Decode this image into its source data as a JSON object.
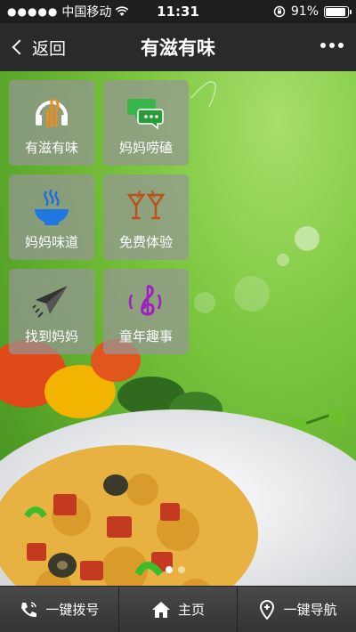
{
  "status_bar": {
    "carrier": "中国移动",
    "time": "11:31",
    "battery": "91%",
    "battery_level": 0.91
  },
  "nav": {
    "back_label": "返回",
    "title": "有滋有味"
  },
  "tiles": [
    {
      "label": "有滋有味",
      "icon": "headphones-utensils-icon"
    },
    {
      "label": "妈妈唠磕",
      "icon": "chat-bubbles-icon"
    },
    {
      "label": "妈妈味道",
      "icon": "steaming-bowl-icon"
    },
    {
      "label": "免费体验",
      "icon": "cocktail-glasses-icon"
    },
    {
      "label": "找到妈妈",
      "icon": "paper-plane-icon"
    },
    {
      "label": "童年趣事",
      "icon": "music-note-icon"
    }
  ],
  "colors": {
    "background_green": "#7cc63f",
    "tile_bg": "#969696",
    "footer_bg": "#3c3c3c"
  },
  "footer": {
    "call_label": "一键拨号",
    "home_label": "主页",
    "nav_label": "一键导航"
  },
  "pager": {
    "current": 1,
    "total": 2
  }
}
